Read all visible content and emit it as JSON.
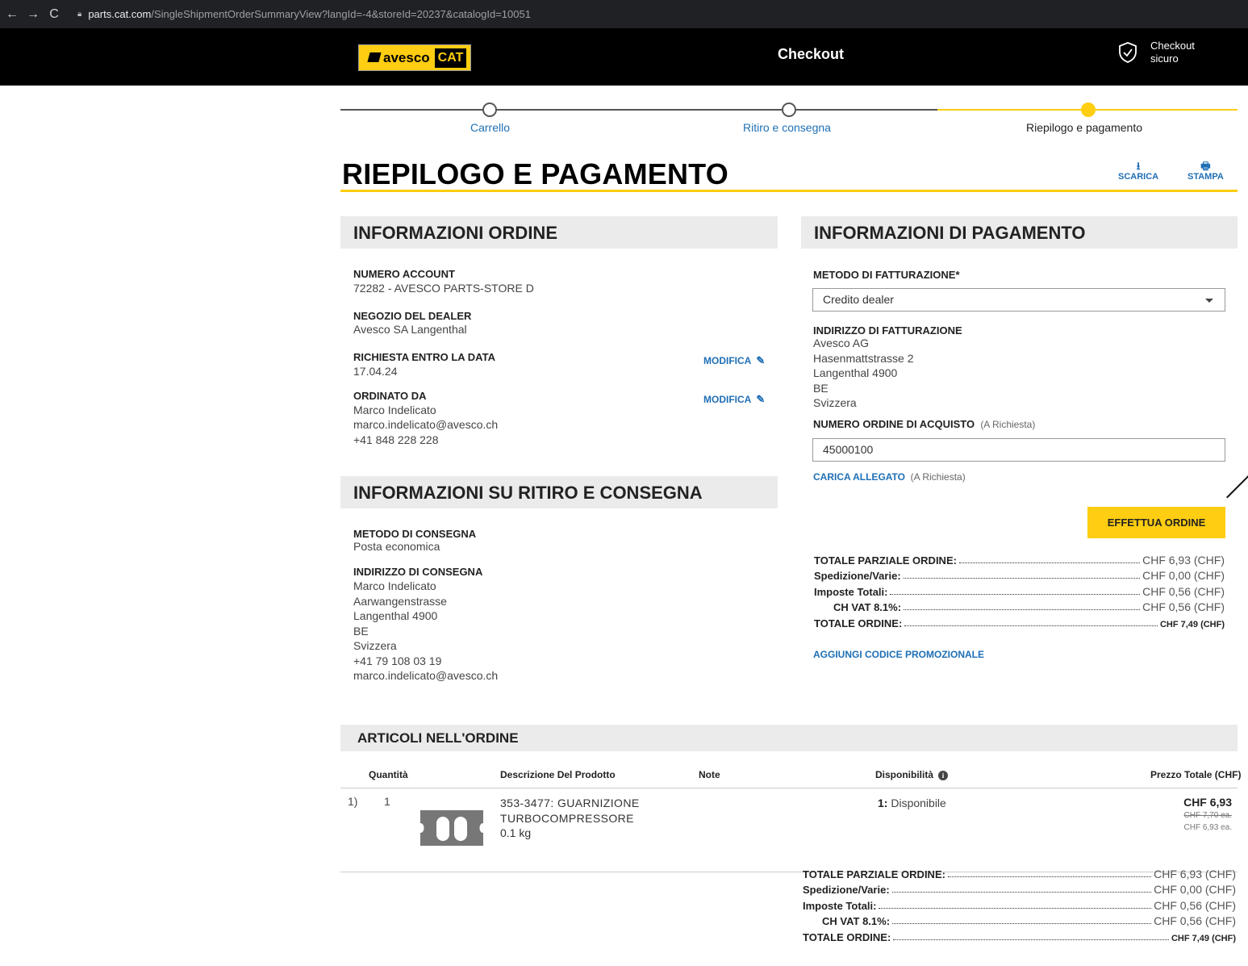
{
  "browser": {
    "url_host": "parts.cat.com",
    "url_path": "/SingleShipmentOrderSummaryView?langId=-4&storeId=20237&catalogId=10051"
  },
  "header": {
    "logo_text": "avesco",
    "logo_cat": "CAT",
    "title": "Checkout",
    "secure_line1": "Checkout",
    "secure_line2": "sicuro"
  },
  "progress": {
    "steps": [
      {
        "label": "Carrello",
        "state": "done"
      },
      {
        "label": "Ritiro e consegna",
        "state": "done"
      },
      {
        "label": "Riepilogo e pagamento",
        "state": "active"
      }
    ]
  },
  "page": {
    "title": "RIEPILOGO E PAGAMENTO",
    "download_label": "SCARICA",
    "print_label": "STAMPA"
  },
  "order_info": {
    "heading": "INFORMAZIONI ORDINE",
    "account_label": "NUMERO ACCOUNT",
    "account_value": "72282 - AVESCO PARTS-STORE D",
    "dealer_label": "NEGOZIO DEL DEALER",
    "dealer_value": "Avesco SA Langenthal",
    "date_label": "RICHIESTA ENTRO LA DATA",
    "date_value": "17.04.24",
    "ordered_by_label": "ORDINATO DA",
    "ordered_by_name": "Marco Indelicato",
    "ordered_by_email": "marco.indelicato@avesco.ch",
    "ordered_by_phone": "+41 848 228 228",
    "edit_label": "MODIFICA"
  },
  "delivery": {
    "heading": "INFORMAZIONI SU RITIRO E CONSEGNA",
    "method_label": "METODO DI CONSEGNA",
    "method_value": "Posta economica",
    "address_label": "INDIRIZZO DI CONSEGNA",
    "address_lines": [
      "Marco Indelicato",
      "Aarwangenstrasse",
      "Langenthal 4900",
      "BE",
      "Svizzera",
      "+41 79 108 03 19",
      "marco.indelicato@avesco.ch"
    ]
  },
  "payment": {
    "heading": "INFORMAZIONI DI PAGAMENTO",
    "billing_method_label": "METODO DI FATTURAZIONE*",
    "billing_method_value": "Credito dealer",
    "billing_address_label": "INDIRIZZO DI FATTURAZIONE",
    "billing_address_lines": [
      "Avesco AG",
      "Hasenmattstrasse 2",
      "Langenthal 4900",
      "BE",
      "Svizzera"
    ],
    "po_label": "NUMERO ORDINE DI ACQUISTO",
    "po_hint": "(A Richiesta)",
    "po_value": "45000100",
    "attach_label": "CARICA ALLEGATO",
    "attach_hint": "(A Richiesta)",
    "place_order": "EFFETTUA ORDINE",
    "promo_label": "AGGIUNGI CODICE PROMOZIONALE"
  },
  "totals": {
    "subtotal_label": "TOTALE PARZIALE ORDINE:",
    "subtotal_value": "CHF 6,93 (CHF)",
    "shipping_label": "Spedizione/Varie:",
    "shipping_value": "CHF 0,00 (CHF)",
    "tax_label": "Imposte Totali:",
    "tax_value": "CHF 0,56 (CHF)",
    "vat_label": "CH VAT 8.1%:",
    "vat_value": "CHF 0,56 (CHF)",
    "total_label": "TOTALE ORDINE:",
    "total_value": "CHF 7,49 (CHF)"
  },
  "items": {
    "heading": "ARTICOLI NELL'ORDINE",
    "columns": {
      "qty": "Quantità",
      "desc": "Descrizione Del Prodotto",
      "notes": "Note",
      "avail": "Disponibilità",
      "price": "Prezzo Totale (CHF)"
    },
    "rows": [
      {
        "index": "1)",
        "qty": "1",
        "desc_line1": "353-3477: GUARNIZIONE",
        "desc_line2": "TURBOCOMPRESSORE",
        "weight": "0.1 kg",
        "avail_qty": "1:",
        "avail_status": "Disponibile",
        "price": "CHF 6,93",
        "old_price": "CHF 7,70 ea.",
        "unit_price": "CHF 6,93 ea."
      }
    ]
  }
}
